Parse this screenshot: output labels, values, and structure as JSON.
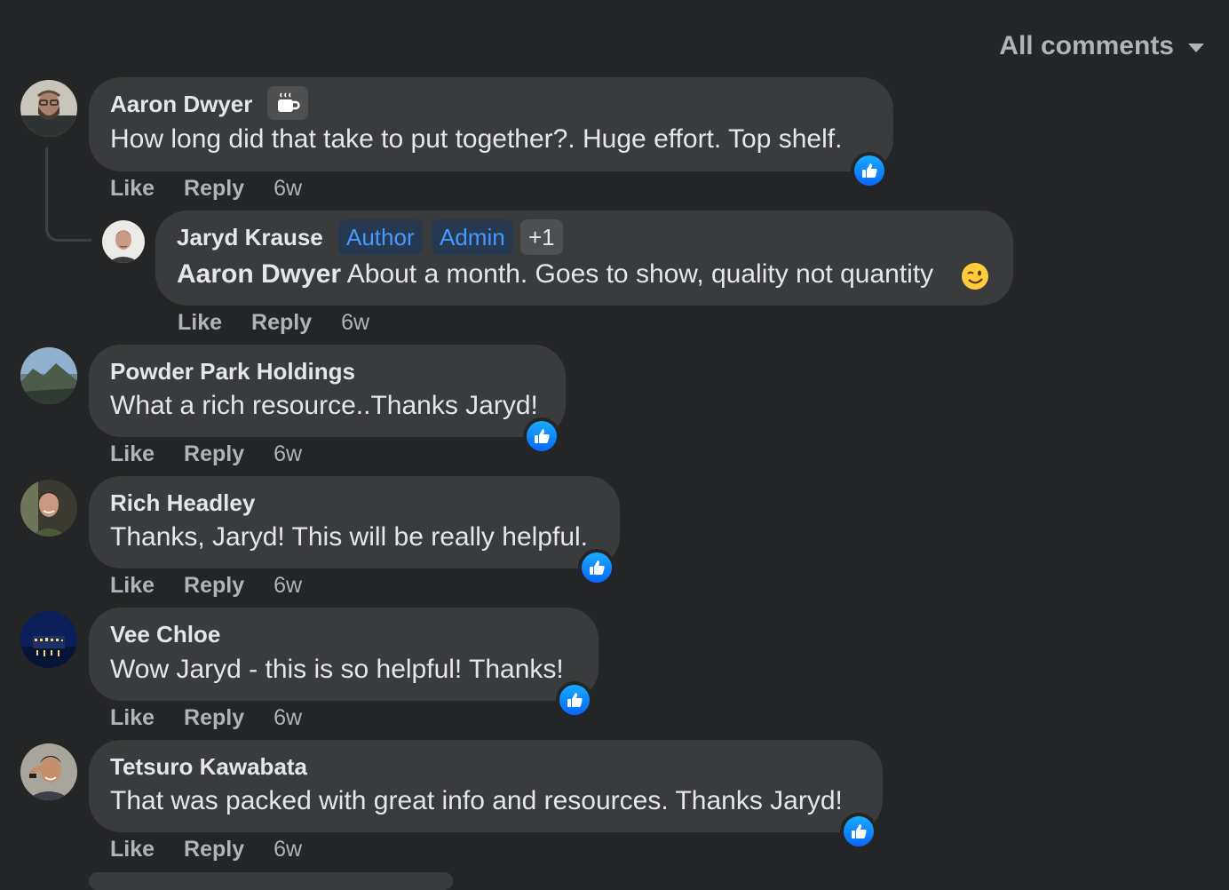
{
  "filter": {
    "label": "All comments"
  },
  "actions": {
    "like": "Like",
    "reply": "Reply"
  },
  "comments": [
    {
      "author": "Aaron Dwyer",
      "text": "How long did that take to put together?. Huge effort. Top shelf.",
      "time": "6w"
    },
    {
      "author": "Jaryd Krause",
      "badges": [
        "Author",
        "Admin",
        "+1"
      ],
      "mention": "Aaron Dwyer",
      "text": " About a month. Goes to show, quality not quantity",
      "time": "6w"
    },
    {
      "author": "Powder Park Holdings",
      "text": "What a rich resource..Thanks Jaryd!",
      "time": "6w"
    },
    {
      "author": "Rich Headley",
      "text": "Thanks, Jaryd! This will be really helpful.",
      "time": "6w"
    },
    {
      "author": "Vee Chloe",
      "text": "Wow Jaryd - this is so helpful! Thanks!",
      "time": "6w"
    },
    {
      "author": "Tetsuro Kawabata",
      "text": "That was packed with great info and resources. Thanks Jaryd!",
      "time": "6w"
    }
  ],
  "icons": {
    "filter_caret": "chevron-down-icon",
    "reaction": "thumbs-up-icon",
    "badge_emoji": "coffee-cup-icon",
    "inline_emoji": "winking-face-icon"
  },
  "colors": {
    "background": "#242526",
    "bubble": "#3a3b3c",
    "like_blue": "#0866ff",
    "badge_blue": "#4599ff"
  }
}
